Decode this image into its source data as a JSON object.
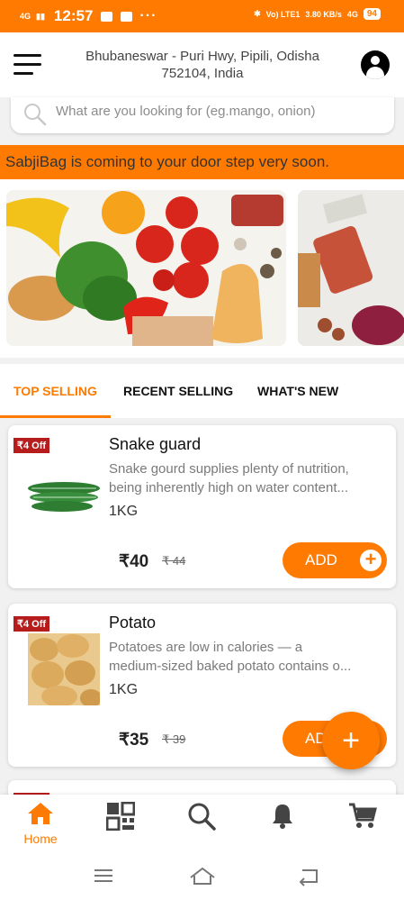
{
  "status_bar": {
    "signal_left": "4G",
    "time": "12:57",
    "dots": "···",
    "volte": "Vo) LTE1",
    "speed": "3.80 KB/s",
    "network": "4G",
    "battery": "94"
  },
  "header": {
    "address": "Bhubaneswar - Puri Hwy, Pipili, Odisha 752104, India"
  },
  "search": {
    "placeholder": "What are you looking for (eg.mango, onion)"
  },
  "banner": {
    "text": "SabjiBag is coming to your door step very soon."
  },
  "tabs": [
    {
      "label": "TOP SELLING",
      "active": true
    },
    {
      "label": "RECENT SELLING",
      "active": false
    },
    {
      "label": "WHAT'S NEW",
      "active": false
    }
  ],
  "products": [
    {
      "discount": "₹4 Off",
      "name": "Snake guard",
      "description_line1": "Snake gourd supplies plenty of nutrition,",
      "description_line2": "being inherently high on water content...",
      "unit": "1KG",
      "price": "₹40",
      "old_price": "₹ 44",
      "add_label": "ADD",
      "image_icon": "snake-gourd-image"
    },
    {
      "discount": "₹4 Off",
      "name": "Potato",
      "description_line1": "Potatoes are low in calories — a",
      "description_line2": "medium-sized baked potato contains o...",
      "unit": "1KG",
      "price": "₹35",
      "old_price": "₹ 39",
      "add_label": "ADD",
      "image_icon": "potato-image"
    }
  ],
  "fab": {
    "label": "+"
  },
  "bottom_nav": {
    "home_label": "Home",
    "items": [
      "home-icon",
      "qr-code-icon",
      "search-icon",
      "bell-icon",
      "cart-icon"
    ]
  },
  "colors": {
    "accent": "#ff7a00",
    "badge": "#b71c1c"
  }
}
